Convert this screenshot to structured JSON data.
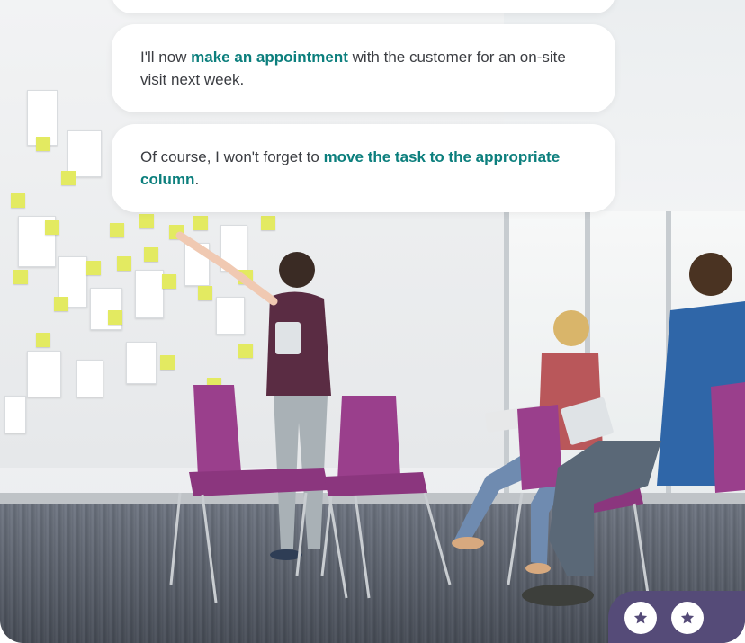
{
  "messages": [
    {
      "parts": []
    },
    {
      "parts": [
        {
          "text": "I'll now ",
          "highlight": false
        },
        {
          "text": "make an appointment",
          "highlight": true
        },
        {
          "text": " with the customer for an on-site visit next week.",
          "highlight": false
        }
      ]
    },
    {
      "parts": [
        {
          "text": "Of course, I won't forget to ",
          "highlight": false
        },
        {
          "text": "move the task to the appropriate column",
          "highlight": true
        },
        {
          "text": ".",
          "highlight": false
        }
      ]
    }
  ],
  "colors": {
    "highlight": "#0c7f7d",
    "rating_panel": "#554b78",
    "star_icon": "#554b78",
    "chair": "#9a3f8c",
    "sticky_note": "#e3ea61"
  },
  "icons": {
    "rating_1": "star-icon",
    "rating_2": "star-icon"
  }
}
